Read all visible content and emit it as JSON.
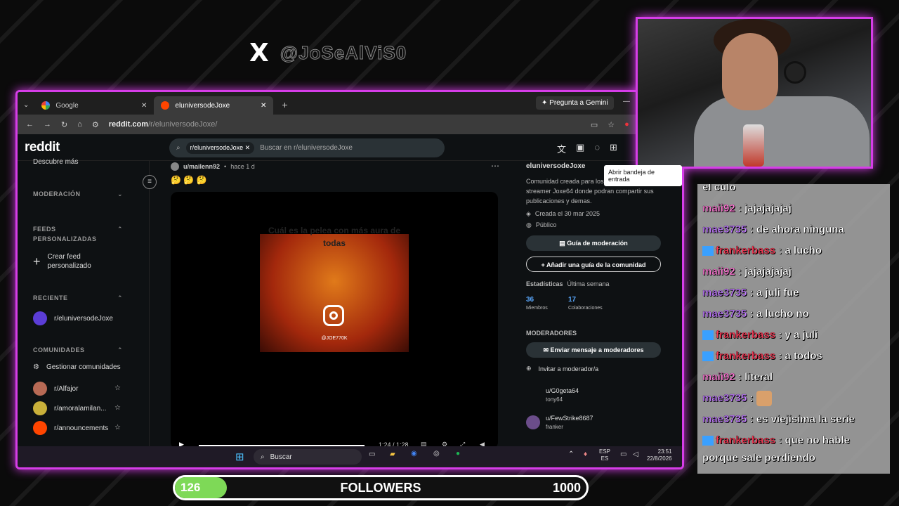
{
  "overlay": {
    "x_handle": "@JoSeAlViS0",
    "followers": {
      "current": "126",
      "label": "FOLLOWERS",
      "goal": "1000",
      "progress_fraction": 0.126
    }
  },
  "browser": {
    "tabs": [
      {
        "label": "Google"
      },
      {
        "label": "eluniversodeJoxe"
      }
    ],
    "gemini_label": "Pregunta a Gemini",
    "url_host": "reddit.com",
    "url_path": "/r/eluniversodeJoxe/"
  },
  "reddit": {
    "logo": "reddit",
    "search_chip": "r/eluniversodeJoxe",
    "search_placeholder": "Buscar en r/eluniversodeJoxe",
    "tooltip": "Abrir bandeja de entrada",
    "sidebar": {
      "top_item": "Descubre más",
      "sec_moderacion": "MODERACIÓN",
      "sec_feeds": "FEEDS PERSONALIZADAS",
      "crear_feed": "Crear feed personalizado",
      "sec_reciente": "RECIENTE",
      "recent_item": "r/eluniversodeJoxe",
      "sec_comunidades": "COMUNIDADES",
      "gestionar": "Gestionar comunidades",
      "communities": [
        "r/Alfajor",
        "r/amoralamilan...",
        "r/announcements"
      ]
    },
    "post": {
      "author": "u/mailenn92",
      "time": "hace 1 d",
      "emojis": "🤔 🤔 🤔",
      "video_text": "Cuál es la pelea con más aura de todas",
      "ig_handle": "@JOE770K",
      "video_time": "1:24 / 1:28"
    },
    "right": {
      "name": "eluniversodeJoxe",
      "desc": "Comunidad creada para los seguidores del streamer Joxe64 donde podran compartir sus publicaciones y demas.",
      "created": "Creada el 30 mar 2025",
      "visibility": "Público",
      "guide_btn": "Guía de moderación",
      "add_guide_btn": "Añadir una guía de la comunidad",
      "stats_label": "Estadísticas",
      "stats_period": "Última semana",
      "members_value": "36",
      "members_label": "Miembros",
      "contrib_value": "17",
      "contrib_label": "Colaboraciones",
      "mods_label": "MODERADORES",
      "msg_mods": "Enviar mensaje a moderadores",
      "invite": "Invitar a moderador/a",
      "mod1_name": "u/G0geta64",
      "mod1_sub": "tony64",
      "mod2_name": "u/FewStrike8687",
      "mod2_sub": "franker"
    }
  },
  "taskbar": {
    "search": "Buscar",
    "lang": "ESP",
    "lang2": "ES",
    "time": "23:51",
    "date": "22/8/2026"
  },
  "chat": {
    "messages": [
      {
        "user": "",
        "text": "el culo"
      },
      {
        "user": "maii92",
        "text": ": jajajajajaj"
      },
      {
        "user": "mae3735",
        "text": ": de ahora ninguna"
      },
      {
        "user": "frankerbass",
        "text": ": a lucho"
      },
      {
        "user": "maii92",
        "text": ": jajajajajaj"
      },
      {
        "user": "mae3735",
        "text": ": a juli fue"
      },
      {
        "user": "mae3735",
        "text": ": a lucho no"
      },
      {
        "user": "frankerbass",
        "text": ": y a juli"
      },
      {
        "user": "frankerbass",
        "text": ": a todos"
      },
      {
        "user": "maii92",
        "text": ": literal"
      },
      {
        "user": "mae3735",
        "text": ":"
      },
      {
        "user": "mae3735",
        "text": ": es viejisima la serie"
      },
      {
        "user": "frankerbass",
        "text": ": que no hable"
      },
      {
        "user": "",
        "text": "porque sale perdiendo"
      }
    ]
  }
}
